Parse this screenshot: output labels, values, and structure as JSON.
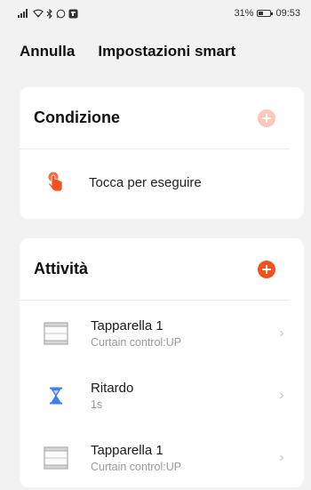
{
  "status_bar": {
    "battery_text": "31%",
    "time": "09:53"
  },
  "header": {
    "cancel_label": "Annulla",
    "title": "Impostazioni smart"
  },
  "condition": {
    "heading": "Condizione",
    "add_icon": "plus-circle-icon",
    "items": [
      {
        "label": "Tocca per eseguire",
        "icon": "tap-hand-icon"
      }
    ]
  },
  "activity": {
    "heading": "Attività",
    "add_icon": "plus-circle-icon",
    "items": [
      {
        "name": "Tapparella 1",
        "detail": "Curtain control:UP",
        "icon": "curtain-icon"
      },
      {
        "name": "Ritardo",
        "detail": "1s",
        "icon": "hourglass-icon"
      },
      {
        "name": "Tapparella 1",
        "detail": "Curtain control:UP",
        "icon": "curtain-icon"
      }
    ]
  },
  "colors": {
    "accent": "#f4511e",
    "accent_disabled": "#fbc7bc",
    "hourglass": "#3d7ff0",
    "background": "#f2f2f2"
  }
}
